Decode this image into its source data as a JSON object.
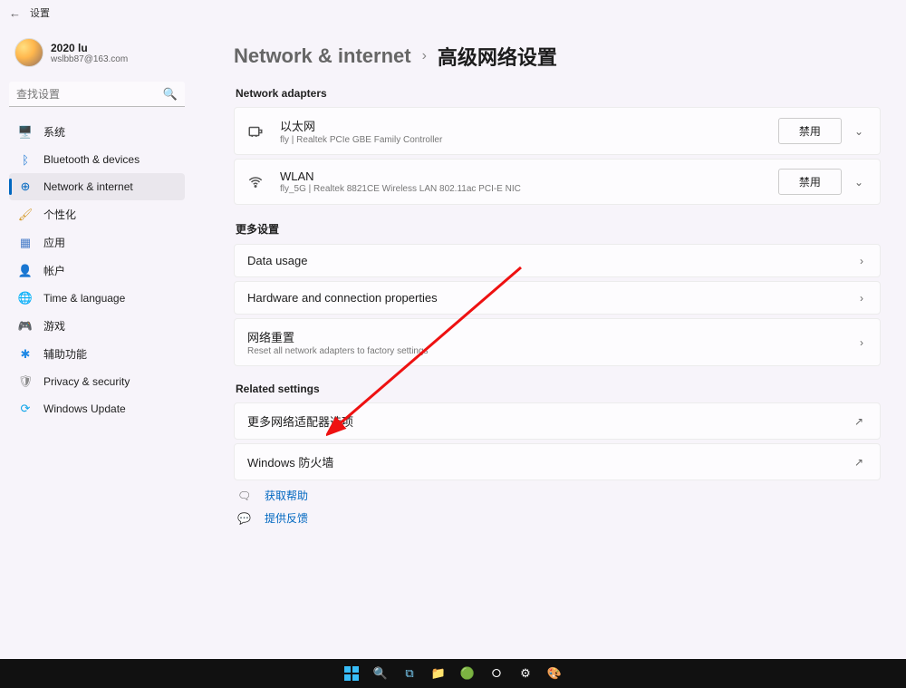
{
  "window": {
    "title": "设置"
  },
  "user": {
    "name": "2020 lu",
    "email": "wslbb87@163.com"
  },
  "search": {
    "placeholder": "查找设置"
  },
  "nav": {
    "items": [
      {
        "label": "系统",
        "icon": "🖥️",
        "color": "#2b6cb0"
      },
      {
        "label": "Bluetooth & devices",
        "icon": "ᛒ",
        "color": "#1976d2"
      },
      {
        "label": "Network & internet",
        "icon": "⊕",
        "color": "#0067c0",
        "active": true
      },
      {
        "label": "个性化",
        "icon": "🖌",
        "color": "#d49a2a"
      },
      {
        "label": "应用",
        "icon": "▦",
        "color": "#4a7ec9"
      },
      {
        "label": "帐户",
        "icon": "👤",
        "color": "#2aa0c8"
      },
      {
        "label": "Time & language",
        "icon": "🌐",
        "color": "#3a8dc0"
      },
      {
        "label": "游戏",
        "icon": "🎮",
        "color": "#7a7a7a"
      },
      {
        "label": "辅助功能",
        "icon": "✱",
        "color": "#1e88e5"
      },
      {
        "label": "Privacy & security",
        "icon": "🛡",
        "color": "#888"
      },
      {
        "label": "Windows Update",
        "icon": "⟳",
        "color": "#0ea5e9"
      }
    ]
  },
  "breadcrumb": {
    "parent": "Network & internet",
    "current": "高级网络设置"
  },
  "sections": {
    "adapters_label": "Network adapters",
    "more_label": "更多设置",
    "related_label": "Related settings"
  },
  "adapters": [
    {
      "title": "以太网",
      "sub": "fly | Realtek PCIe GBE Family Controller",
      "button": "禁用"
    },
    {
      "title": "WLAN",
      "sub": "fly_5G | Realtek 8821CE Wireless LAN 802.11ac PCI-E NIC",
      "button": "禁用"
    }
  ],
  "more": [
    {
      "title": "Data usage"
    },
    {
      "title": "Hardware and connection properties"
    },
    {
      "title": "网络重置",
      "sub": "Reset all network adapters to factory settings"
    }
  ],
  "related": [
    {
      "title": "更多网络适配器选项"
    },
    {
      "title": "Windows 防火墙"
    }
  ],
  "help": {
    "get_help": "获取帮助",
    "feedback": "提供反馈"
  },
  "taskbar": {
    "items": [
      "start",
      "search",
      "taskview",
      "explorer",
      "edge",
      "chrome",
      "settings",
      "paint"
    ]
  }
}
